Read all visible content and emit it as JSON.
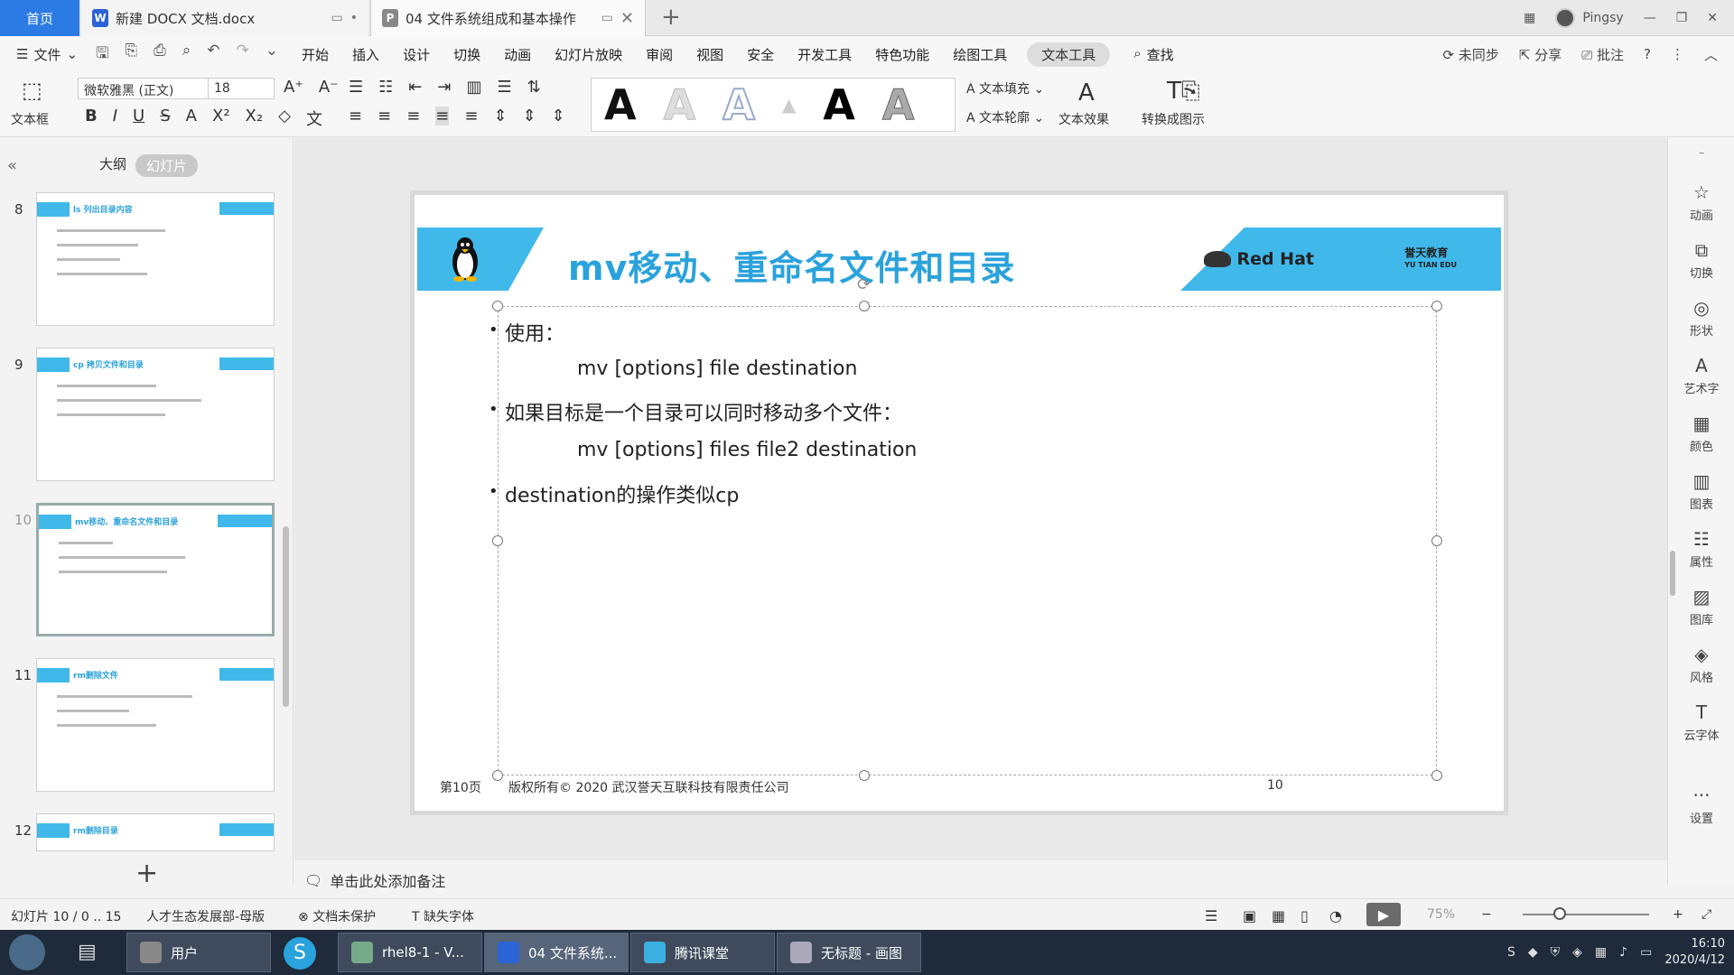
{
  "tabs": {
    "home": "首页",
    "doc1": "新建 DOCX 文档.docx",
    "doc2": "04 文件系统组成和基本操作"
  },
  "user": "Pingsy",
  "menu": {
    "file": "文件",
    "items": [
      "开始",
      "插入",
      "设计",
      "切换",
      "动画",
      "幻灯片放映",
      "审阅",
      "视图",
      "安全",
      "开发工具",
      "特色功能",
      "绘图工具"
    ],
    "active": "文本工具",
    "search": "查找",
    "sync": "未同步",
    "share": "分享",
    "comment": "批注"
  },
  "ribbon": {
    "textbox": "文本框",
    "font": "微软雅黑 (正文)",
    "size": "18",
    "fill": "文本填充",
    "outline": "文本轮廓",
    "effect": "文本效果",
    "convert": "转换成图示"
  },
  "panel": {
    "outline": "大纲",
    "slides": "幻灯片",
    "thumbs": [
      {
        "num": "8",
        "title": "ls 列出目录内容"
      },
      {
        "num": "9",
        "title": "cp 拷贝文件和目录"
      },
      {
        "num": "10",
        "title": "mv移动、重命名文件和目录"
      },
      {
        "num": "11",
        "title": "rm删除文件"
      },
      {
        "num": "12",
        "title": "rm删除目录"
      }
    ]
  },
  "slide": {
    "title": "mv移动、重命名文件和目录",
    "redhat": "Red Hat",
    "yutian_cn": "誉天教育",
    "yutian_en": "YU TIAN EDU",
    "b1": "使用：",
    "s1": "mv [options] file destination",
    "b2": "如果目标是一个目录可以同时移动多个文件：",
    "s2": "mv [options] files file2 destination",
    "b3": "destination的操作类似cp",
    "page_label": "第10页",
    "copyright": "版权所有© 2020 武汉誉天互联科技有限责任公司",
    "page_num": "10"
  },
  "notes": "单击此处添加备注",
  "right_tools": [
    "动画",
    "切换",
    "形状",
    "艺术字",
    "颜色",
    "图表",
    "属性",
    "图库",
    "风格",
    "云字体",
    "设置"
  ],
  "status": {
    "slide": "幻灯片 10 / 0 .. 15",
    "theme": "人才生态发展部-母版",
    "protect": "文档未保护",
    "fonts": "缺失字体",
    "zoom": "75%"
  },
  "taskbar": {
    "items": [
      "用户",
      "rhel8-1 - V...",
      "04 文件系统...",
      "腾讯课堂",
      "无标题 - 画图"
    ],
    "time": "16:10",
    "date": "2020/4/12"
  }
}
